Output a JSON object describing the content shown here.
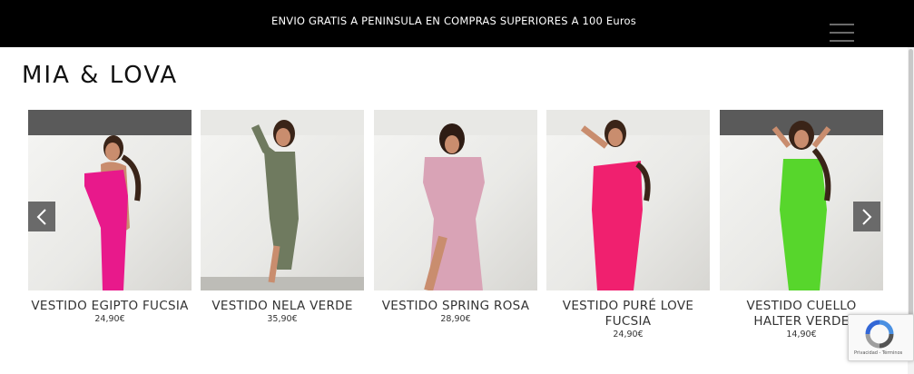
{
  "announcement": {
    "text": "ENVIO GRATIS A PENINSULA EN COMPRAS SUPERIORES A 100 Euros"
  },
  "header": {
    "logo_text": "MIA & LOVA"
  },
  "products": [
    {
      "name": "VESTIDO EGIPTO FUCSIA",
      "price": "24,90€",
      "dress_color": "#e8198b",
      "icon": "product-photo"
    },
    {
      "name": "VESTIDO NELA VERDE",
      "price": "35,90€",
      "dress_color": "#6f7a5f",
      "icon": "product-photo"
    },
    {
      "name": "VESTIDO SPRING ROSA",
      "price": "28,90€",
      "dress_color": "#d9a3b6",
      "icon": "product-photo"
    },
    {
      "name": "VESTIDO PURÉ LOVE FUCSIA",
      "price": "24,90€",
      "dress_color": "#f0206f",
      "icon": "product-photo"
    },
    {
      "name": "VESTIDO CUELLO HALTER VERDE",
      "price": "14,90€",
      "dress_color": "#57d62c",
      "icon": "product-photo"
    }
  ],
  "carousel": {
    "prev_icon": "chevron-left-icon",
    "next_icon": "chevron-right-icon"
  },
  "recaptcha": {
    "links": "Privacidad - Términos",
    "icon": "recaptcha-logo-icon"
  },
  "colors": {
    "topbar": "#000000",
    "arrow_bg": "#6a6a6a",
    "page_bg": "#ffffff"
  }
}
